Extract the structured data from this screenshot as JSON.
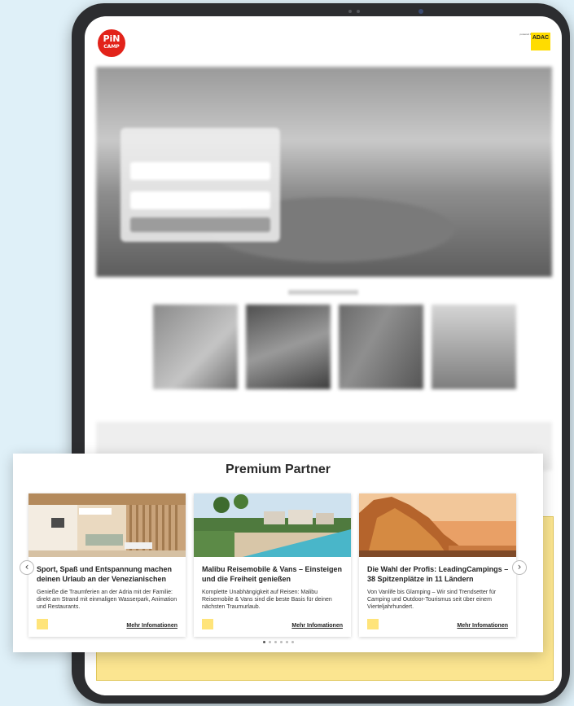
{
  "brand": {
    "logo_line1": "PiN",
    "logo_line2": "CAMP",
    "powered_by": "powered by",
    "partner_logo": "ADAC"
  },
  "premium": {
    "title": "Premium Partner",
    "cards": [
      {
        "title": "Sport, Spaß und Entspannung machen deinen Urlaub an der Venezianischen",
        "text": "Genieße die Traumferien an der Adria mit der Familie: direkt am Strand mit einmaligen Wasserpark, Animation und Restaurants.",
        "link": "Mehr Infomationen"
      },
      {
        "title": "Malibu Reisemobile & Vans – Einsteigen und die Freiheit genießen",
        "text": "Komplette Unabhängigkeit auf Reisen: Malibu Reisemobile & Vans sind die beste Basis für deinen nächsten Traumurlaub.",
        "link": "Mehr Infomationen"
      },
      {
        "title": "Die Wahl der Profis: LeadingCampings – 38 Spitzenplätze in 11 Ländern",
        "text": "Von Vanlife bis Glamping – Wir sind Trendsetter für Camping und Outdoor-Tourismus seit über einem Vierteljahrhundert.",
        "link": "Mehr Infomationen"
      }
    ],
    "prev_icon": "chevron-left-icon",
    "next_icon": "chevron-right-icon",
    "prev_glyph": "‹",
    "next_glyph": "›",
    "carousel_pages": 6,
    "carousel_active_page": 1
  },
  "colors": {
    "brand_red": "#e2231a",
    "adac_yellow": "#ffdc00",
    "badge_yellow": "#ffe47a",
    "panel_yellow": "#fbe590"
  }
}
